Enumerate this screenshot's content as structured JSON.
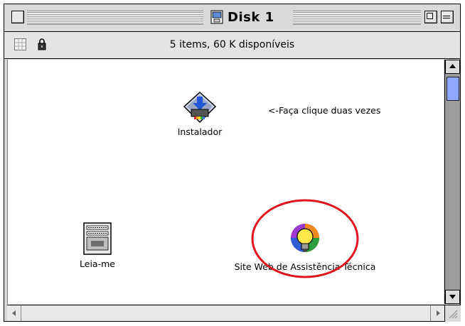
{
  "window": {
    "title": "Disk 1",
    "info": "5 items, 60 K disponíveis"
  },
  "items": [
    {
      "label": "Instalador",
      "icon": "installer-icon"
    },
    {
      "label": "Leia-me",
      "icon": "document-icon"
    },
    {
      "label": "Site Web de Assistência Técnica",
      "icon": "lightbulb-icon"
    }
  ],
  "note": "<-Faça clique duas vezes",
  "colors": {
    "highlight_circle": "#e0141e",
    "scroll_thumb": "#8fa8ff"
  }
}
